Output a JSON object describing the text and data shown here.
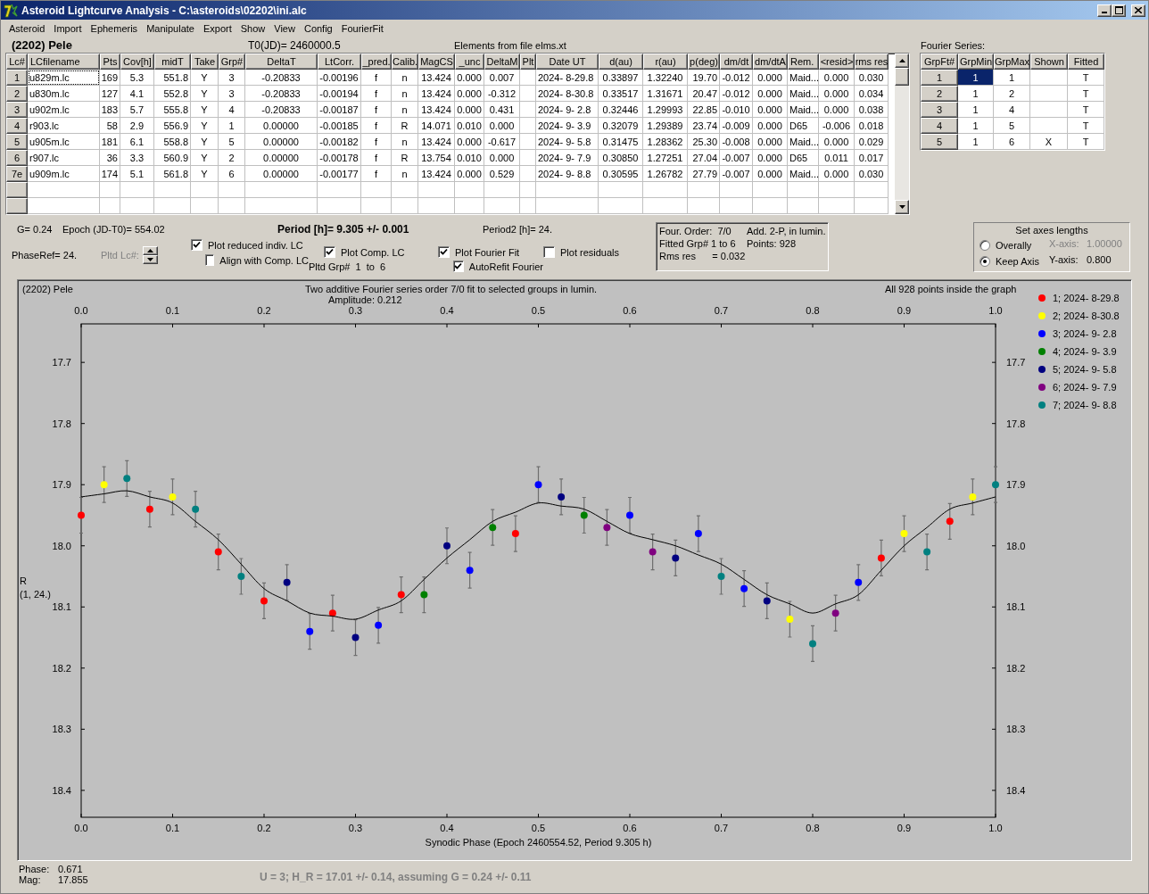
{
  "window": {
    "title": "Asteroid Lightcurve Analysis - C:\\asteroids\\02202\\ini.alc"
  },
  "menu": [
    "Asteroid",
    "Import",
    "Ephemeris",
    "Manipulate",
    "Export",
    "Show",
    "View",
    "Config",
    "FourierFit"
  ],
  "header": {
    "asteroid": "(2202) Pele",
    "t0": "T0(JD)= 2460000.5",
    "elements": "Elements from file elms.xt"
  },
  "table": {
    "columns": [
      "Lc#",
      "LCfilename",
      "Pts",
      "Cov[h]",
      "midT",
      "Take",
      "Grp#",
      "DeltaT",
      "LtCorr.",
      "_pred.",
      "Calib.",
      "MagCS",
      "_unc",
      "DeltaM",
      "Plt",
      "Date UT",
      "d(au)",
      "r(au)",
      "p(deg)",
      "dm/dt",
      "dm/dtA",
      "Rem.",
      "<resid>",
      "rms res"
    ],
    "rows": [
      {
        "focused": true,
        "cells": [
          "1",
          "u829m.lc",
          "169",
          "5.3",
          "551.8",
          "Y",
          "3",
          "-0.20833",
          "-0.00196",
          "f",
          "n",
          "13.424",
          "0.000",
          "0.007",
          null,
          "2024- 8-29.8",
          "0.33897",
          "1.32240",
          "19.70",
          "-0.012",
          "0.000",
          "Maid...",
          "0.000",
          "0.030"
        ]
      },
      {
        "focused": false,
        "cells": [
          "2",
          "u830m.lc",
          "127",
          "4.1",
          "552.8",
          "Y",
          "3",
          "-0.20833",
          "-0.00194",
          "f",
          "n",
          "13.424",
          "0.000",
          "-0.312",
          null,
          "2024- 8-30.8",
          "0.33517",
          "1.31671",
          "20.47",
          "-0.012",
          "0.000",
          "Maid...",
          "0.000",
          "0.034"
        ]
      },
      {
        "focused": false,
        "cells": [
          "3",
          "u902m.lc",
          "183",
          "5.7",
          "555.8",
          "Y",
          "4",
          "-0.20833",
          "-0.00187",
          "f",
          "n",
          "13.424",
          "0.000",
          "0.431",
          null,
          "2024- 9- 2.8",
          "0.32446",
          "1.29993",
          "22.85",
          "-0.010",
          "0.000",
          "Maid...",
          "0.000",
          "0.038"
        ]
      },
      {
        "focused": false,
        "cells": [
          "4",
          "r903.lc",
          "58",
          "2.9",
          "556.9",
          "Y",
          "1",
          "0.00000",
          "-0.00185",
          "f",
          "R",
          "14.071",
          "0.010",
          "0.000",
          null,
          "2024- 9- 3.9",
          "0.32079",
          "1.29389",
          "23.74",
          "-0.009",
          "0.000",
          "D65",
          "-0.006",
          "0.018"
        ]
      },
      {
        "focused": false,
        "cells": [
          "5",
          "u905m.lc",
          "181",
          "6.1",
          "558.8",
          "Y",
          "5",
          "0.00000",
          "-0.00182",
          "f",
          "n",
          "13.424",
          "0.000",
          "-0.617",
          null,
          "2024- 9- 5.8",
          "0.31475",
          "1.28362",
          "25.30",
          "-0.008",
          "0.000",
          "Maid...",
          "0.000",
          "0.029"
        ]
      },
      {
        "focused": false,
        "cells": [
          "6",
          "r907.lc",
          "36",
          "3.3",
          "560.9",
          "Y",
          "2",
          "0.00000",
          "-0.00178",
          "f",
          "R",
          "13.754",
          "0.010",
          "0.000",
          null,
          "2024- 9- 7.9",
          "0.30850",
          "1.27251",
          "27.04",
          "-0.007",
          "0.000",
          "D65",
          "0.011",
          "0.017"
        ]
      },
      {
        "focused": false,
        "cells": [
          "7e",
          "u909m.lc",
          "174",
          "5.1",
          "561.8",
          "Y",
          "6",
          "0.00000",
          "-0.00177",
          "f",
          "n",
          "13.424",
          "0.000",
          "0.529",
          null,
          "2024- 9- 8.8",
          "0.30595",
          "1.26782",
          "27.79",
          "-0.007",
          "0.000",
          "Maid...",
          "0.000",
          "0.030"
        ]
      }
    ]
  },
  "fourier": {
    "title": "Fourier Series:",
    "columns": [
      "GrpFt#",
      "GrpMin",
      "GrpMax",
      "Shown",
      "Fitted"
    ],
    "rows": [
      {
        "cells": [
          {
            "text": "1",
            "selected": false
          },
          {
            "text": "1",
            "selected": true
          },
          {
            "text": "1",
            "selected": false
          },
          {
            "selected": false
          },
          {
            "text": "T",
            "selected": false
          }
        ]
      },
      {
        "cells": [
          {
            "text": "2",
            "selected": false
          },
          {
            "text": "1",
            "selected": false
          },
          {
            "text": "2",
            "selected": false
          },
          {
            "selected": false
          },
          {
            "text": "T",
            "selected": false
          }
        ]
      },
      {
        "cells": [
          {
            "text": "3",
            "selected": false
          },
          {
            "text": "1",
            "selected": false
          },
          {
            "text": "4",
            "selected": false
          },
          {
            "selected": false
          },
          {
            "text": "T",
            "selected": false
          }
        ]
      },
      {
        "cells": [
          {
            "text": "4",
            "selected": false
          },
          {
            "text": "1",
            "selected": false
          },
          {
            "text": "5",
            "selected": false
          },
          {
            "selected": false
          },
          {
            "text": "T",
            "selected": false
          }
        ]
      },
      {
        "cells": [
          {
            "text": "5",
            "selected": false
          },
          {
            "text": "1",
            "selected": false
          },
          {
            "text": "6",
            "selected": false
          },
          {
            "text": "X",
            "selected": false
          },
          {
            "text": "T",
            "selected": false
          }
        ]
      }
    ]
  },
  "controls": {
    "g": "G= 0.24",
    "epoch": "Epoch (JD-T0)= 554.02",
    "period": "Period [h]= 9.305 +/- 0.001",
    "period2": "Period2 [h]= 24.",
    "phase_ref": "PhaseRef= 24.",
    "pltd_lc": {
      "label": "Pltd Lc#:",
      "disabled": true
    },
    "pltd_grp": "Pltd Grp#  1  to  6",
    "checkboxes": [
      {
        "label": "Plot reduced indiv. LC",
        "checked": true
      },
      {
        "label": "Align with Comp. LC",
        "checked": false
      },
      {
        "label": "Plot Comp. LC",
        "checked": true
      },
      {
        "label": "Plot Fourier Fit",
        "checked": true
      },
      {
        "label": "AutoRefit Fourier",
        "checked": true
      },
      {
        "label": "Plot residuals",
        "checked": false
      }
    ]
  },
  "fit_info": [
    "Four. Order:  7/0",
    "Add. 2-P, in lumin.",
    "Fitted Grp# 1 to 6",
    "Points: 928",
    "Rms res      = 0.032"
  ],
  "axes": {
    "title": "Set axes lengths",
    "options": [
      {
        "label": "Overally",
        "selected": false
      },
      {
        "label": "Keep Axis",
        "selected": true
      }
    ],
    "fields": [
      {
        "label": "X-axis:",
        "value": "1.00000",
        "disabled": true
      },
      {
        "label": "Y-axis:",
        "value": "0.800",
        "disabled": false
      }
    ]
  },
  "plot": {
    "asteroid": "(2202) Pele",
    "title": "Two additive Fourier series order 7/0 fit to selected groups in lumin.",
    "amplitude": "Amplitude: 0.212",
    "points_note": "All 928 points inside the graph",
    "chart_data": {
      "type": "scatter",
      "xlabel": "Synodic Phase (Epoch 2460554.52, Period 9.305 h)",
      "ylabel": "R\n(1, 24.)",
      "x": [
        0,
        0.025,
        0.05,
        0.075,
        0.1,
        0.125,
        0.15,
        0.175,
        0.2,
        0.225,
        0.25,
        0.275,
        0.3,
        0.325,
        0.35,
        0.375,
        0.4,
        0.425,
        0.45,
        0.475,
        0.5,
        0.525,
        0.55,
        0.575,
        0.6,
        0.625,
        0.65,
        0.675,
        0.7,
        0.725,
        0.75,
        0.775,
        0.8,
        0.825,
        0.85,
        0.875,
        0.9,
        0.925,
        0.95,
        0.975,
        1
      ],
      "xlim": [
        0,
        1
      ],
      "ylim": [
        18.444,
        17.637
      ],
      "xticks": [
        {
          "value": 0,
          "label": "0.0"
        },
        {
          "value": 0.1,
          "label": "0.1"
        },
        {
          "value": 0.2,
          "label": "0.2"
        },
        {
          "value": 0.3,
          "label": "0.3"
        },
        {
          "value": 0.4,
          "label": "0.4"
        },
        {
          "value": 0.5,
          "label": "0.5"
        },
        {
          "value": 0.6,
          "label": "0.6"
        },
        {
          "value": 0.7,
          "label": "0.7"
        },
        {
          "value": 0.8,
          "label": "0.8"
        },
        {
          "value": 0.9,
          "label": "0.9"
        },
        {
          "value": 1,
          "label": "1.0"
        }
      ],
      "yticks": [
        {
          "value": 17.7,
          "label": "17.7"
        },
        {
          "value": 17.8,
          "label": "17.8"
        },
        {
          "value": 17.9,
          "label": "17.9"
        },
        {
          "value": 18.0,
          "label": "18.0"
        },
        {
          "value": 18.1,
          "label": "18.1"
        },
        {
          "value": 18.2,
          "label": "18.2"
        },
        {
          "value": 18.3,
          "label": "18.3"
        },
        {
          "value": 18.4,
          "label": "18.4"
        }
      ],
      "series": [
        {
          "name": "1; 2024- 8-29.8",
          "color": "#ff0000",
          "values": [
            17.95,
            null,
            null,
            17.94,
            null,
            null,
            18.01,
            null,
            18.09,
            null,
            null,
            18.11,
            null,
            null,
            18.08,
            null,
            null,
            null,
            null,
            17.98,
            null,
            null,
            null,
            null,
            null,
            null,
            null,
            null,
            null,
            null,
            null,
            null,
            null,
            null,
            null,
            18.02,
            null,
            null,
            17.96,
            null,
            null
          ]
        },
        {
          "name": "2; 2024- 8-30.8",
          "color": "#ffff00",
          "values": [
            null,
            17.9,
            null,
            null,
            17.92,
            null,
            null,
            null,
            null,
            null,
            null,
            null,
            null,
            null,
            null,
            null,
            null,
            null,
            null,
            null,
            null,
            null,
            null,
            null,
            null,
            null,
            null,
            null,
            null,
            null,
            null,
            18.12,
            null,
            null,
            null,
            null,
            17.98,
            null,
            null,
            17.92,
            null
          ]
        },
        {
          "name": "3; 2024- 9- 2.8",
          "color": "#0000ff",
          "values": [
            null,
            null,
            null,
            null,
            null,
            null,
            null,
            null,
            null,
            null,
            18.14,
            null,
            null,
            18.13,
            null,
            null,
            null,
            18.04,
            null,
            null,
            17.9,
            null,
            null,
            null,
            17.95,
            null,
            null,
            17.98,
            null,
            18.07,
            null,
            null,
            null,
            null,
            18.06,
            null,
            null,
            null,
            null,
            null,
            null
          ]
        },
        {
          "name": "4; 2024- 9- 3.9",
          "color": "#008000",
          "values": [
            null,
            null,
            null,
            null,
            null,
            null,
            null,
            null,
            null,
            null,
            null,
            null,
            null,
            null,
            null,
            18.08,
            null,
            null,
            17.97,
            null,
            null,
            null,
            17.95,
            null,
            null,
            null,
            null,
            null,
            null,
            null,
            null,
            null,
            null,
            null,
            null,
            null,
            null,
            null,
            null,
            null,
            null
          ]
        },
        {
          "name": "5; 2024- 9- 5.8",
          "color": "#000080",
          "values": [
            null,
            null,
            null,
            null,
            null,
            null,
            null,
            null,
            null,
            18.06,
            null,
            null,
            18.15,
            null,
            null,
            null,
            18.0,
            null,
            null,
            null,
            null,
            17.92,
            null,
            null,
            null,
            null,
            18.02,
            null,
            null,
            null,
            18.09,
            null,
            null,
            null,
            null,
            null,
            null,
            null,
            null,
            null,
            null
          ]
        },
        {
          "name": "6; 2024- 9- 7.9",
          "color": "#800080",
          "values": [
            null,
            null,
            null,
            null,
            null,
            null,
            null,
            null,
            null,
            null,
            null,
            null,
            null,
            null,
            null,
            null,
            null,
            null,
            null,
            null,
            null,
            null,
            null,
            17.97,
            null,
            18.01,
            null,
            null,
            null,
            null,
            null,
            null,
            null,
            18.11,
            null,
            null,
            null,
            null,
            null,
            null,
            null
          ]
        },
        {
          "name": "7; 2024- 9- 8.8",
          "color": "#008080",
          "values": [
            null,
            null,
            17.89,
            null,
            null,
            17.94,
            null,
            18.05,
            null,
            null,
            null,
            null,
            null,
            null,
            null,
            null,
            null,
            null,
            null,
            null,
            null,
            null,
            null,
            null,
            null,
            null,
            null,
            null,
            18.05,
            null,
            null,
            null,
            18.16,
            null,
            null,
            null,
            null,
            18.01,
            null,
            null,
            17.9
          ]
        },
        {
          "type": "line",
          "color": "#000000",
          "values": [
            17.92,
            17.915,
            17.91,
            17.92,
            17.93,
            17.96,
            17.99,
            18.03,
            18.07,
            18.09,
            18.11,
            18.115,
            18.12,
            18.105,
            18.09,
            18.055,
            18.02,
            17.99,
            17.96,
            17.945,
            17.93,
            17.935,
            17.94,
            17.96,
            17.98,
            17.99,
            18.0,
            18.015,
            18.03,
            18.055,
            18.08,
            18.095,
            18.11,
            18.095,
            18.08,
            18.04,
            18.0,
            17.97,
            17.94,
            17.93,
            17.92
          ]
        }
      ]
    }
  },
  "status": {
    "phase_label": "Phase:",
    "phase": "0.671",
    "mag_label": "Mag:",
    "mag": "17.855",
    "result": "U = 3; H_R = 17.01 +/- 0.14, assuming G = 0.24 +/- 0.11"
  }
}
